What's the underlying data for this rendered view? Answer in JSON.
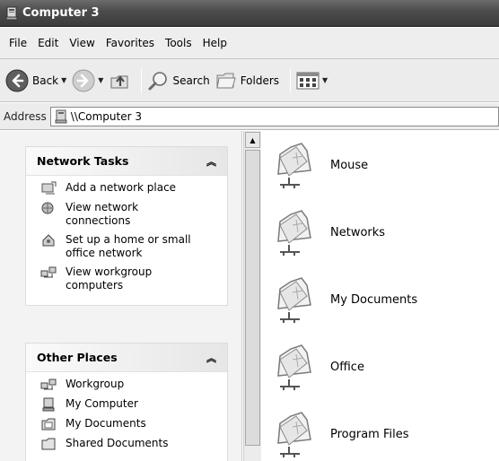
{
  "window": {
    "title": "Computer 3"
  },
  "menu": [
    "File",
    "Edit",
    "View",
    "Favorites",
    "Tools",
    "Help"
  ],
  "toolbar": {
    "back": "Back",
    "search": "Search",
    "folders": "Folders"
  },
  "address": {
    "label": "Address",
    "value": "\\\\Computer 3"
  },
  "network_tasks": {
    "title": "Network Tasks",
    "items": [
      {
        "label": "Add a network place",
        "icon": "add-network-place-icon"
      },
      {
        "label": "View network\nconnections",
        "icon": "network-connections-icon"
      },
      {
        "label": "Set up a home or small\noffice network",
        "icon": "home-network-icon"
      },
      {
        "label": "View workgroup\ncomputers",
        "icon": "workgroup-icon"
      }
    ]
  },
  "other_places": {
    "title": "Other Places",
    "items": [
      {
        "label": "Workgroup",
        "icon": "workgroup-icon"
      },
      {
        "label": "My Computer",
        "icon": "my-computer-icon"
      },
      {
        "label": "My Documents",
        "icon": "my-documents-icon"
      },
      {
        "label": "Shared Documents",
        "icon": "shared-documents-icon"
      }
    ]
  },
  "shares": [
    {
      "name": "Mouse"
    },
    {
      "name": "Networks"
    },
    {
      "name": "My Documents"
    },
    {
      "name": "Office"
    },
    {
      "name": "Program Files"
    }
  ]
}
